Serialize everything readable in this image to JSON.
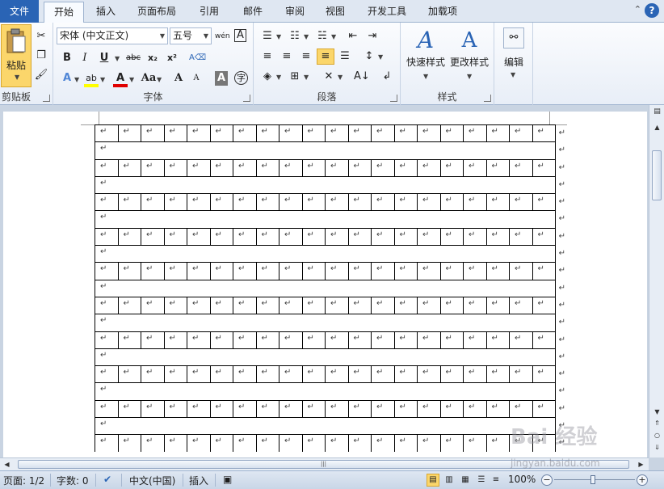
{
  "tabs": {
    "file": "文件",
    "items": [
      "开始",
      "插入",
      "页面布局",
      "引用",
      "邮件",
      "审阅",
      "视图",
      "开发工具",
      "加载项"
    ],
    "active": "开始"
  },
  "ribbon": {
    "clipboard": {
      "label": "剪贴板",
      "paste": "粘贴"
    },
    "font": {
      "label": "字体",
      "font_name": "宋体 (中文正文)",
      "font_size": "五号",
      "bold": "B",
      "italic": "I",
      "underline": "U",
      "strike": "abc",
      "sub": "x₂",
      "sup": "x²",
      "grow": "A",
      "shrink": "A",
      "case": "Aa",
      "clear": "A",
      "char": "字",
      "wen": "wén",
      "border_a": "A"
    },
    "paragraph": {
      "label": "段落"
    },
    "styles": {
      "label": "样式",
      "quick": "快速样式",
      "change": "更改样式"
    },
    "editing": {
      "label": "编辑",
      "edit": "编辑"
    }
  },
  "document": {
    "cell_mark": "↵",
    "rows": 19,
    "columns": 20
  },
  "status": {
    "page": "页面: 1/2",
    "words": "字数: 0",
    "language": "中文(中国)",
    "mode": "插入",
    "zoom": "100%"
  },
  "watermark": {
    "brand": "Bai 经验",
    "url": "jingyan.baidu.com"
  }
}
